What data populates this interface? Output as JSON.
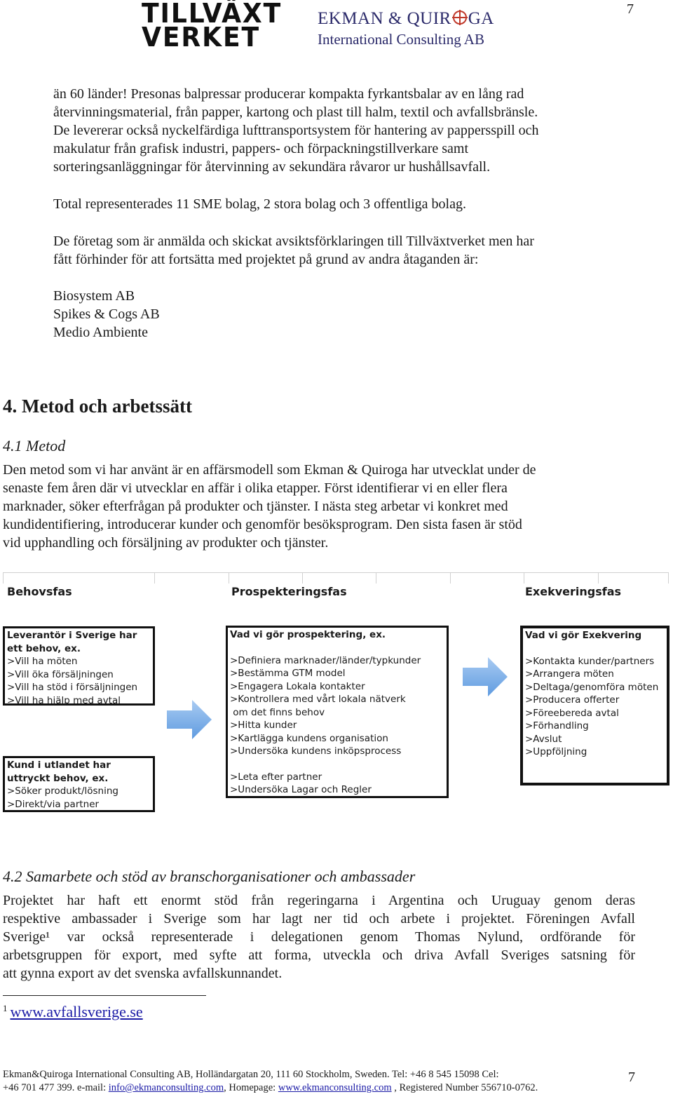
{
  "header": {
    "page_number": "7",
    "logo_left": {
      "line1": "TILLVÄXT",
      "line2": "VERKET"
    },
    "logo_right": {
      "line1_a": "EKMAN & QUIR",
      "line1_b": "GA",
      "line2": "International Consulting AB"
    }
  },
  "intro_paragraph": [
    "än 60 länder! Presonas balpressar producerar kompakta fyrkantsbalar av en lång rad",
    "återvinningsmaterial, från papper, kartong och plast till halm, textil och avfallsbränsle.",
    "De levererar också nyckelfärdiga lufttransportsystem för hantering av pappersspill och",
    "makulatur från grafisk industri, pappers- och förpackningstillverkare samt",
    "sorteringsanläggningar för återvinning av sekundära råvaror ur hushållsavfall."
  ],
  "total_paragraph": "Total representerades 11 SME bolag, 2 stora bolag och 3 offentliga bolag.",
  "withdrawn_paragraph": [
    "De företag som är anmälda och skickat avsiktsförklaringen till Tillväxtverket men har",
    "fått förhinder för att fortsätta med projektet på grund av andra åtaganden är:"
  ],
  "withdrawn_companies": [
    "Biosystem AB",
    "Spikes & Cogs AB",
    "Medio Ambiente"
  ],
  "section4": {
    "heading": "4.  Metod och arbetssätt",
    "sub1": {
      "heading": "4.1 Metod",
      "lines": [
        "Den metod som vi har använt är en affärsmodell som Ekman & Quiroga har utvecklat under de",
        "senaste fem åren där vi utvecklar en affär i olika etapper. Först identifierar vi en eller flera",
        "marknader, söker efterfrågan på produkter och tjänster. I nästa steg arbetar vi konkret med",
        "kundidentifiering, introducerar kunder och genomför besöksprogram. Den sista fasen är stöd",
        "vid upphandling och försäljning av produkter och tjänster."
      ]
    },
    "diagram": {
      "phases": [
        "Behovsfas",
        "Prospekteringsfas",
        "Exekveringsfas"
      ],
      "box_supplier": {
        "title": [
          "Leverantör i Sverige har",
          "ett behov, ex."
        ],
        "items": [
          ">Vill ha möten",
          ">Vill öka försäljningen",
          ">Vill ha stöd i försäljningen",
          ">Vill ha hjälp med avtal"
        ]
      },
      "box_customer": {
        "title": [
          "Kund i utlandet har",
          "uttryckt behov, ex."
        ],
        "items": [
          ">Söker produkt/lösning",
          ">Direkt/via partner"
        ]
      },
      "box_prospecting": {
        "title": "Vad vi gör prospektering, ex.",
        "items": [
          ">Definiera marknader/länder/typkunder",
          ">Bestämma GTM model",
          ">Engagera Lokala kontakter",
          ">Kontrollera med vårt lokala nätverk",
          " om det finns behov",
          ">Hitta kunder",
          ">Kartlägga kundens organisation",
          ">Undersöka kundens inköpsprocess"
        ],
        "items2": [
          ">Leta efter partner",
          ">Undersöka Lagar och Regler"
        ]
      },
      "box_execution": {
        "title": "Vad vi gör Exekvering",
        "items": [
          ">Kontakta kunder/partners",
          ">Arrangera möten",
          ">Deltaga/genomföra möten",
          ">Producera offerter",
          ">Föreebereda avtal",
          ">Förhandling",
          ">Avslut",
          ">Uppföljning"
        ]
      },
      "arrow_color": "#7fb0e8"
    },
    "sub2": {
      "heading": "4.2 Samarbete och stöd av branschorganisationer och ambassader",
      "lines": [
        "Projektet har haft ett enormt stöd från regeringarna i Argentina och Uruguay genom deras",
        "respektive ambassader i Sverige som har lagt ner tid och arbete i projektet. Föreningen Avfall",
        "Sverige¹ var också representerade i delegationen genom Thomas Nylund, ordförande för",
        "arbetsgruppen för export, med syfte att forma, utveckla och driva Avfall Sveriges satsning för",
        "att gynna export av det svenska avfallskunnandet."
      ]
    }
  },
  "footnote": {
    "number": "1",
    "link": "www.avfallsverige.se"
  },
  "footer": {
    "line1": "Ekman&Quiroga International Consulting AB, Holländargatan 20, 111 60 Stockholm, Sweden. Tel: +46 8 545 15098 Cel:",
    "line2_a": "+46 701 477 399. e-mail: ",
    "email": "info@ekmanconsulting.com",
    "line2_b": ", Homepage: ",
    "homepage": "www.ekmanconsulting.com",
    "line2_c": " , Registered Number 556710-0762.",
    "page_number": "7"
  }
}
